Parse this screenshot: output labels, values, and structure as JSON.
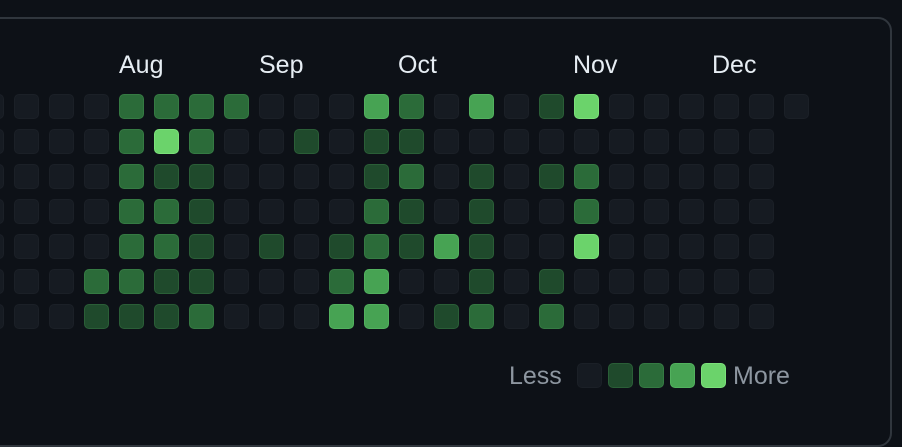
{
  "months": [
    {
      "label": "Aug",
      "left": 0
    },
    {
      "label": "Sep",
      "left": 0
    },
    {
      "label": "Oct",
      "left": 0
    },
    {
      "label": "Nov",
      "left": 0
    },
    {
      "label": "Dec",
      "left": 0
    }
  ],
  "legend": {
    "less_label": "Less",
    "more_label": "More"
  },
  "colors": {
    "background": "#0d1117",
    "panel_border": "#30363d",
    "level_0": "#161b22",
    "level_1": "#1f4a2c",
    "level_2": "#2b6b39",
    "level_3": "#47a353",
    "level_4": "#6bd36b",
    "month_text": "#e6edf3",
    "legend_text": "#8d96a0"
  },
  "contribution_levels": [
    [
      0,
      0,
      0,
      0,
      2,
      2,
      2,
      2,
      0,
      0,
      0,
      3,
      2,
      0,
      3,
      0,
      1,
      4,
      0,
      0,
      0,
      0,
      0,
      0
    ],
    [
      0,
      0,
      0,
      0,
      2,
      4,
      2,
      0,
      0,
      1,
      0,
      1,
      1,
      0,
      0,
      0,
      0,
      0,
      0,
      0,
      0,
      0,
      0
    ],
    [
      0,
      0,
      0,
      0,
      2,
      1,
      1,
      0,
      0,
      0,
      0,
      1,
      2,
      0,
      1,
      0,
      1,
      2,
      0,
      0,
      0,
      0,
      0
    ],
    [
      0,
      0,
      0,
      0,
      2,
      2,
      1,
      0,
      0,
      0,
      0,
      2,
      1,
      0,
      1,
      0,
      0,
      2,
      0,
      0,
      0,
      0,
      0
    ],
    [
      0,
      0,
      0,
      0,
      2,
      2,
      1,
      0,
      1,
      0,
      1,
      2,
      1,
      3,
      1,
      0,
      0,
      4,
      0,
      0,
      0,
      0,
      0
    ],
    [
      0,
      0,
      0,
      2,
      2,
      1,
      1,
      0,
      0,
      0,
      2,
      3,
      0,
      0,
      1,
      0,
      1,
      0,
      0,
      0,
      0,
      0,
      0
    ],
    [
      0,
      0,
      0,
      1,
      1,
      1,
      2,
      0,
      0,
      0,
      3,
      3,
      0,
      1,
      2,
      0,
      2,
      0,
      0,
      0,
      0,
      0,
      0
    ]
  ]
}
